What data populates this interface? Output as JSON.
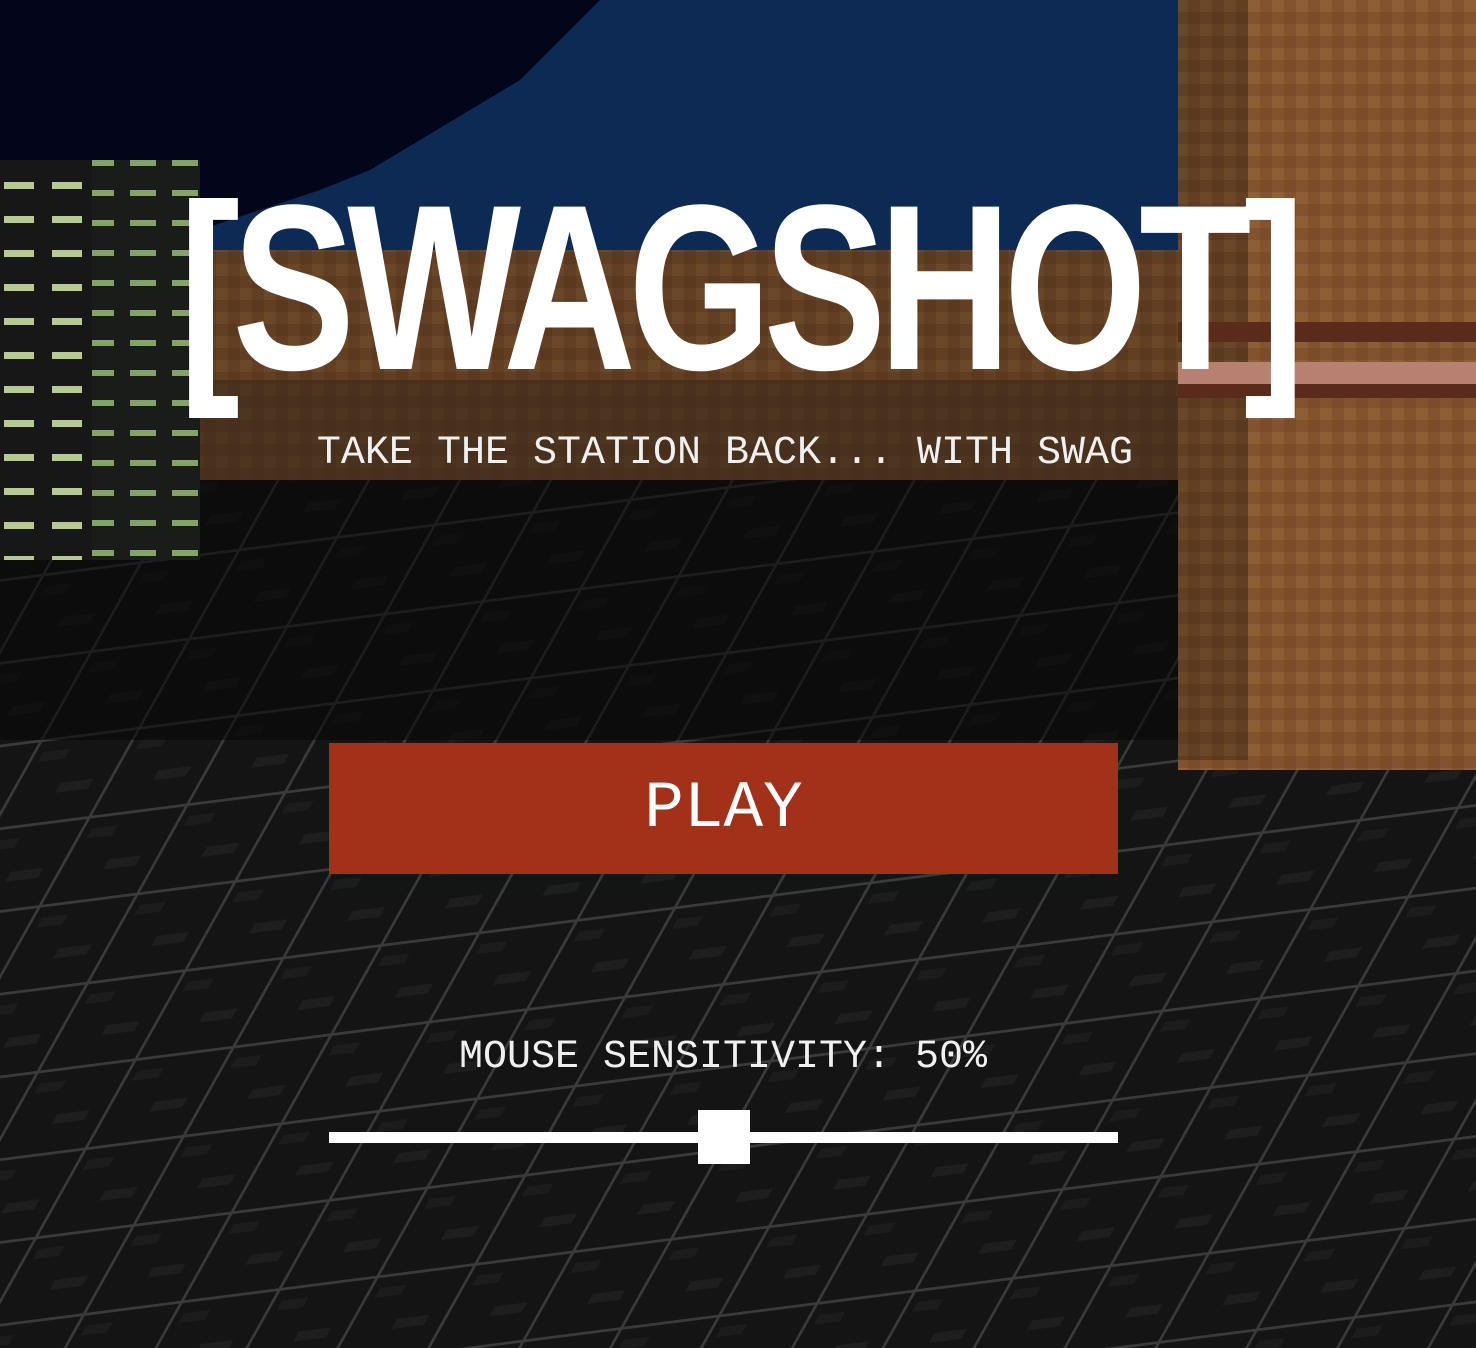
{
  "menu": {
    "title": "[SWAGSHOT]",
    "subtitle": "TAKE THE STATION BACK... WITH SWAG",
    "play_label": "PLAY",
    "sensitivity": {
      "label_prefix": "MOUSE SENSITIVITY: ",
      "value": 50,
      "unit": "%",
      "label": "MOUSE SENSITIVITY: 50%"
    }
  },
  "colors": {
    "play_button": "#a13219",
    "text": "#ffffff",
    "sky": "#0d2a55",
    "night_sky": "#03051a",
    "crate": "#8a5a2e",
    "floor": "#141414"
  },
  "icons": {
    "slider_thumb": "square-thumb"
  }
}
